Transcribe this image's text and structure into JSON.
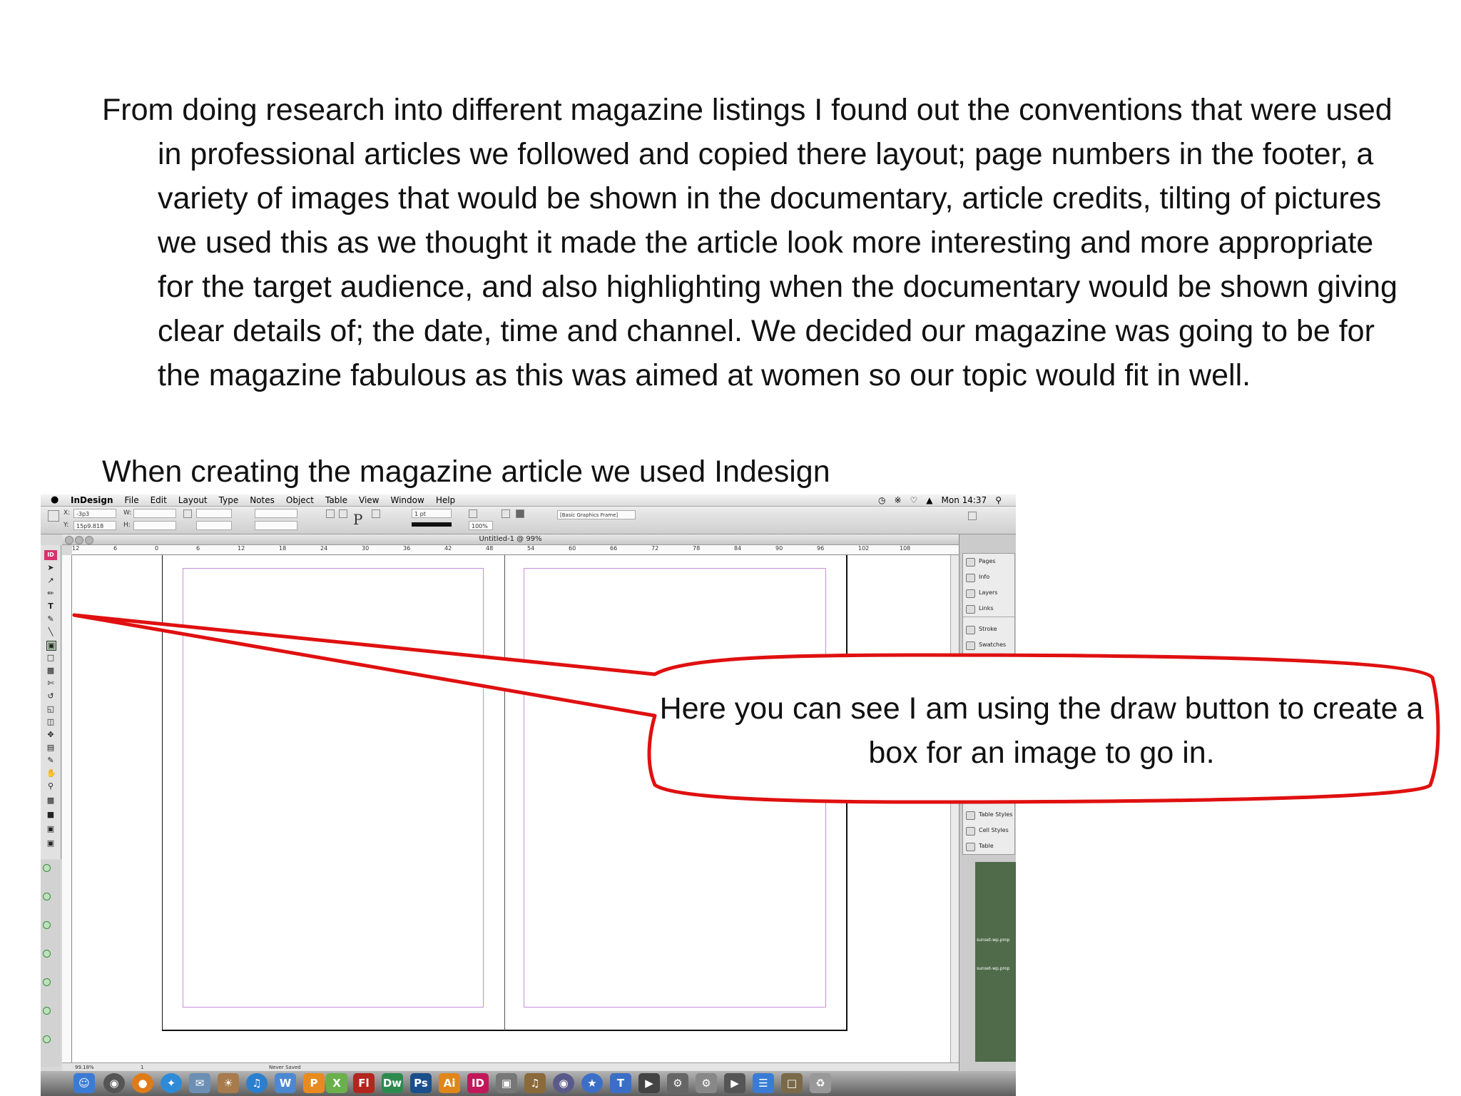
{
  "slide": {
    "paragraph_1": "From doing research into different magazine listings I found out the conventions that were used in professional articles we followed and copied there layout; page numbers in the footer, a variety of images that would be shown in the documentary, article credits, tilting of pictures we used this as we thought it made the article look more interesting and more appropriate for the target audience, and also highlighting when the documentary would be shown giving clear details of; the date, time and channel. We decided our magazine was going to be for the magazine fabulous as this was aimed at women so our topic would fit in well.",
    "paragraph_2": "When creating the magazine article we used Indesign",
    "callout_text": "Here you can see I am using the draw button to create a box for an image to go in.",
    "callout_color": "#e01010"
  },
  "menubar": {
    "apple": "",
    "items": [
      "InDesign",
      "File",
      "Edit",
      "Layout",
      "Type",
      "Notes",
      "Object",
      "Table",
      "View",
      "Window",
      "Help"
    ],
    "clock": "Mon 14:37"
  },
  "control_panel": {
    "x_value": "-3p3",
    "y_value": "15p9.818",
    "x_label": "X:",
    "y_label": "Y:",
    "w_label": "W:",
    "h_label": "H:",
    "stroke_weight": "1 pt",
    "zoom_field": "100%",
    "object_style": "[Basic Graphics Frame]"
  },
  "document": {
    "title": "Untitled-1 @ 99%",
    "ruler_ticks": [
      "12",
      "6",
      "0",
      "6",
      "12",
      "18",
      "24",
      "30",
      "36",
      "42",
      "48",
      "54",
      "60",
      "66",
      "72",
      "78",
      "84",
      "90",
      "96",
      "102",
      "108"
    ],
    "zoom_status": "99.18%",
    "page_status": "1",
    "save_status": "Never Saved"
  },
  "toolbox": {
    "badge": "ID"
  },
  "panels": {
    "items": [
      "Pages",
      "Info",
      "Layers",
      "Links",
      "Stroke",
      "Swatches",
      "Table Styles",
      "Cell Styles",
      "Table"
    ]
  },
  "dock": {
    "icons": [
      "Fl",
      "Dw",
      "Ps",
      "Ai",
      "ID"
    ]
  },
  "timeline": {
    "clip_label_1": "sunset-wp.prop",
    "clip_label_2": "sunset-wp.prop"
  }
}
